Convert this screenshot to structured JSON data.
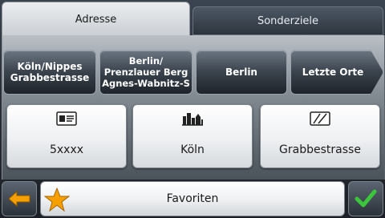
{
  "tabs": [
    {
      "label": "Adresse",
      "active": true
    },
    {
      "label": "Sonderziele",
      "active": false
    }
  ],
  "recent_destinations": [
    {
      "label": "Köln/Nippes\nGrabbestrasse"
    },
    {
      "label": "Berlin/\nPrenzlauer Berg\nAgnes-Wabnitz-S"
    },
    {
      "label": "Berlin"
    },
    {
      "label": "Letzte Orte"
    }
  ],
  "address_fields": [
    {
      "label": "5xxxx",
      "icon": "postcode-card-icon"
    },
    {
      "label": "Köln",
      "icon": "city-skyline-icon"
    },
    {
      "label": "Grabbestrasse",
      "icon": "street-road-icon"
    }
  ],
  "bottom": {
    "back_icon": "back-arrow-icon",
    "favorites_label": "Favoriten",
    "favorites_icon": "star-icon",
    "ok_icon": "checkmark-icon"
  },
  "colors": {
    "accent_orange": "#f5a000",
    "check_green": "#3cc43c"
  }
}
